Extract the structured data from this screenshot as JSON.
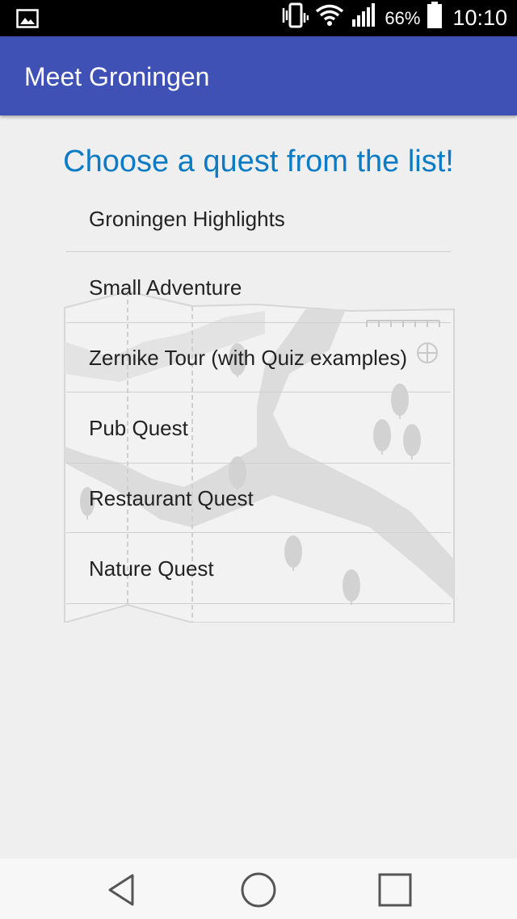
{
  "status_bar": {
    "battery_percent": "66%",
    "time": "10:10",
    "icons": [
      "image-notification-icon",
      "vibrate-icon",
      "wifi-icon",
      "signal-icon",
      "battery-icon"
    ]
  },
  "app_bar": {
    "title": "Meet Groningen"
  },
  "main": {
    "heading": "Choose a quest from the list!",
    "quests": [
      "Groningen Highlights",
      "Small Adventure",
      "Zernike Tour (with Quiz examples)",
      "Pub Quest",
      "Restaurant Quest",
      "Nature Quest"
    ]
  },
  "colors": {
    "app_bar": "#3f51b5",
    "heading": "#0a7bc4",
    "background": "#efefef"
  },
  "nav_bar": {
    "icons": [
      "back-icon",
      "home-icon",
      "recents-icon"
    ]
  }
}
